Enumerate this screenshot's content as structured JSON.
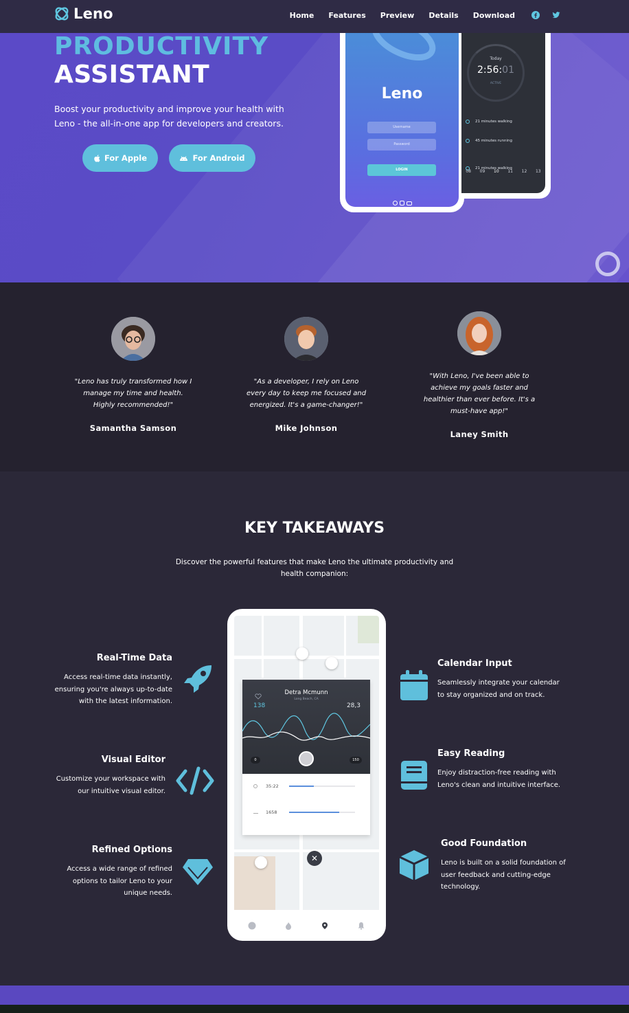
{
  "nav": {
    "brand": "Leno",
    "links": [
      "Home",
      "Features",
      "Preview",
      "Details",
      "Download"
    ]
  },
  "hero": {
    "title_line1": "PRODUCTIVITY",
    "title_line2": "ASSISTANT",
    "description": "Boost your productivity and improve your health with Leno - the all-in-one app for developers and creators.",
    "button_apple": "For Apple",
    "button_android": "For Android",
    "login_phone": {
      "logo": "Leno",
      "username_placeholder": "Username",
      "password_placeholder": "Password",
      "login_button": "LOGIN"
    },
    "timer_phone": {
      "today": "Today",
      "time_main": "2:56:",
      "time_dim": "01",
      "status": "ACTIVE",
      "activities": [
        "21 minutes walking",
        "45 minutes running",
        "21 minutes walking"
      ],
      "days": [
        "08",
        "09",
        "10",
        "11",
        "12",
        "13"
      ]
    }
  },
  "testimonials": [
    {
      "quote": "\"Leno has truly transformed how I manage my time and health. Highly recommended!\"",
      "name": "Samantha Samson"
    },
    {
      "quote": "\"As a developer, I rely on Leno every day to keep me focused and energized. It's a game-changer!\"",
      "name": "Mike Johnson"
    },
    {
      "quote": "\"With Leno, I've been able to achieve my goals faster and healthier than ever before. It's a must-have app!\"",
      "name": "Laney Smith"
    }
  ],
  "features": {
    "title": "KEY TAKEAWAYS",
    "subtitle": "Discover the powerful features that make Leno the ultimate productivity and health companion:",
    "items": [
      {
        "title": "Real-Time Data",
        "desc": "Access real-time data instantly, ensuring you're always up-to-date with the latest information.",
        "icon": "rocket-icon"
      },
      {
        "title": "Visual Editor",
        "desc": "Customize your workspace with our intuitive visual editor.",
        "icon": "code-icon"
      },
      {
        "title": "Refined Options",
        "desc": "Access a wide range of refined options to tailor Leno to your unique needs.",
        "icon": "diamond-icon"
      },
      {
        "title": "Calendar Input",
        "desc": "Seamlessly integrate your calendar to stay organized and on track.",
        "icon": "calendar-icon"
      },
      {
        "title": "Easy Reading",
        "desc": "Enjoy distraction-free reading with Leno's clean and intuitive interface.",
        "icon": "book-icon"
      },
      {
        "title": "Good Foundation",
        "desc": "Leno is built on a solid foundation of user feedback and cutting-edge technology.",
        "icon": "cube-icon"
      }
    ],
    "phone": {
      "name": "Detra Mcmunn",
      "location": "Long Beach, CA",
      "stat_left": "138",
      "stat_right": "28,3",
      "scale_min": "0",
      "scale_max": "150",
      "row1_value": "35:22",
      "row1_progress": 0.38,
      "row2_value": "1658",
      "row2_progress": 0.76
    }
  },
  "colors": {
    "accent": "#5fbfdc",
    "hero_bg": "#5b4ac7",
    "dark_bg": "#25222f",
    "section_bg": "#2b2838"
  }
}
